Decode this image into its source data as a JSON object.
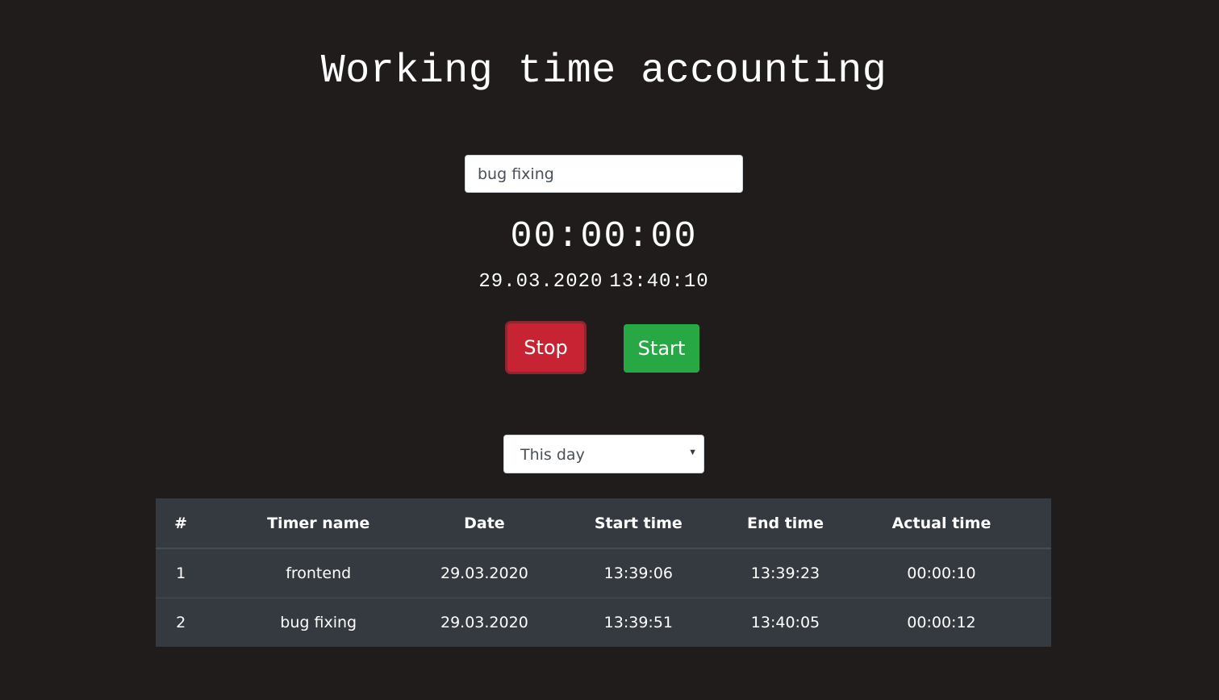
{
  "title": "Working time accounting",
  "timer_input": {
    "value": "bug fixing"
  },
  "clock": "00:00:00",
  "current": {
    "date": "29.03.2020",
    "time": "13:40:10"
  },
  "buttons": {
    "stop_label": "Stop",
    "start_label": "Start"
  },
  "period_select": {
    "selected": "This day"
  },
  "table": {
    "headers": [
      "#",
      "Timer name",
      "Date",
      "Start time",
      "End time",
      "Actual time"
    ],
    "rows": [
      [
        "1",
        "frontend",
        "29.03.2020",
        "13:39:06",
        "13:39:23",
        "00:00:10"
      ],
      [
        "2",
        "bug fixing",
        "29.03.2020",
        "13:39:51",
        "13:40:05",
        "00:00:12"
      ]
    ]
  },
  "colors": {
    "background": "#201c1c",
    "stop": "#c82333",
    "start": "#28a745",
    "table": "#343a40"
  }
}
